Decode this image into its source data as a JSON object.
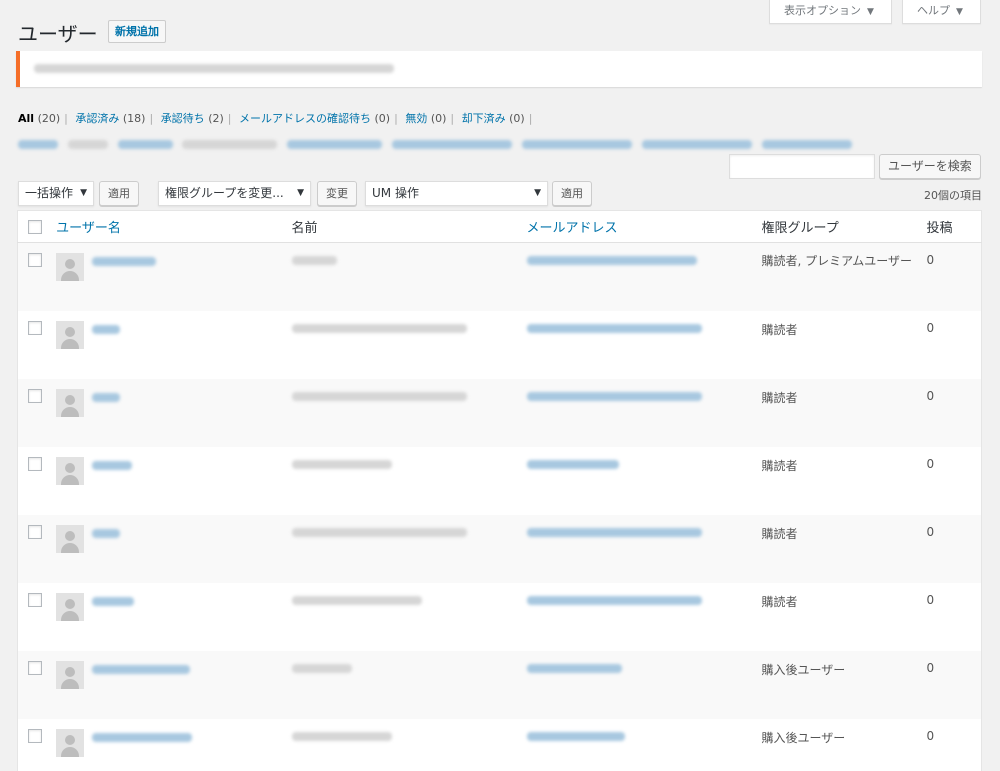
{
  "header": {
    "title": "ユーザー",
    "add_new": "新規追加",
    "screen_options": "表示オプション",
    "help": "ヘルプ"
  },
  "filters": [
    {
      "label": "All",
      "count": "(20)"
    },
    {
      "label": "承認済み",
      "count": "(18)"
    },
    {
      "label": "承認待ち",
      "count": "(2)"
    },
    {
      "label": "メールアドレスの確認待ち",
      "count": "(0)"
    },
    {
      "label": "無効",
      "count": "(0)"
    },
    {
      "label": "却下済み",
      "count": "(0)"
    }
  ],
  "search": {
    "button": "ユーザーを検索",
    "value": ""
  },
  "toolbar": {
    "bulk_action": "一括操作",
    "apply": "適用",
    "role_change": "権限グループを変更...",
    "change": "変更",
    "um_action": "UM 操作",
    "um_apply": "適用",
    "item_count": "20個の項目"
  },
  "table": {
    "columns": [
      "ユーザー名",
      "名前",
      "メールアドレス",
      "権限グループ",
      "投稿"
    ],
    "rows": [
      {
        "role": "購読者, プレミアムユーザー",
        "posts": "0"
      },
      {
        "role": "購読者",
        "posts": "0"
      },
      {
        "role": "購読者",
        "posts": "0"
      },
      {
        "role": "購読者",
        "posts": "0"
      },
      {
        "role": "購読者",
        "posts": "0"
      },
      {
        "role": "購読者",
        "posts": "0"
      },
      {
        "role": "購入後ユーザー",
        "posts": "0"
      },
      {
        "role": "購入後ユーザー",
        "posts": "0"
      }
    ]
  },
  "icons": {
    "dropdown": "caret-down-icon",
    "avatar": "default-avatar-icon",
    "checkbox": "checkbox-icon"
  }
}
